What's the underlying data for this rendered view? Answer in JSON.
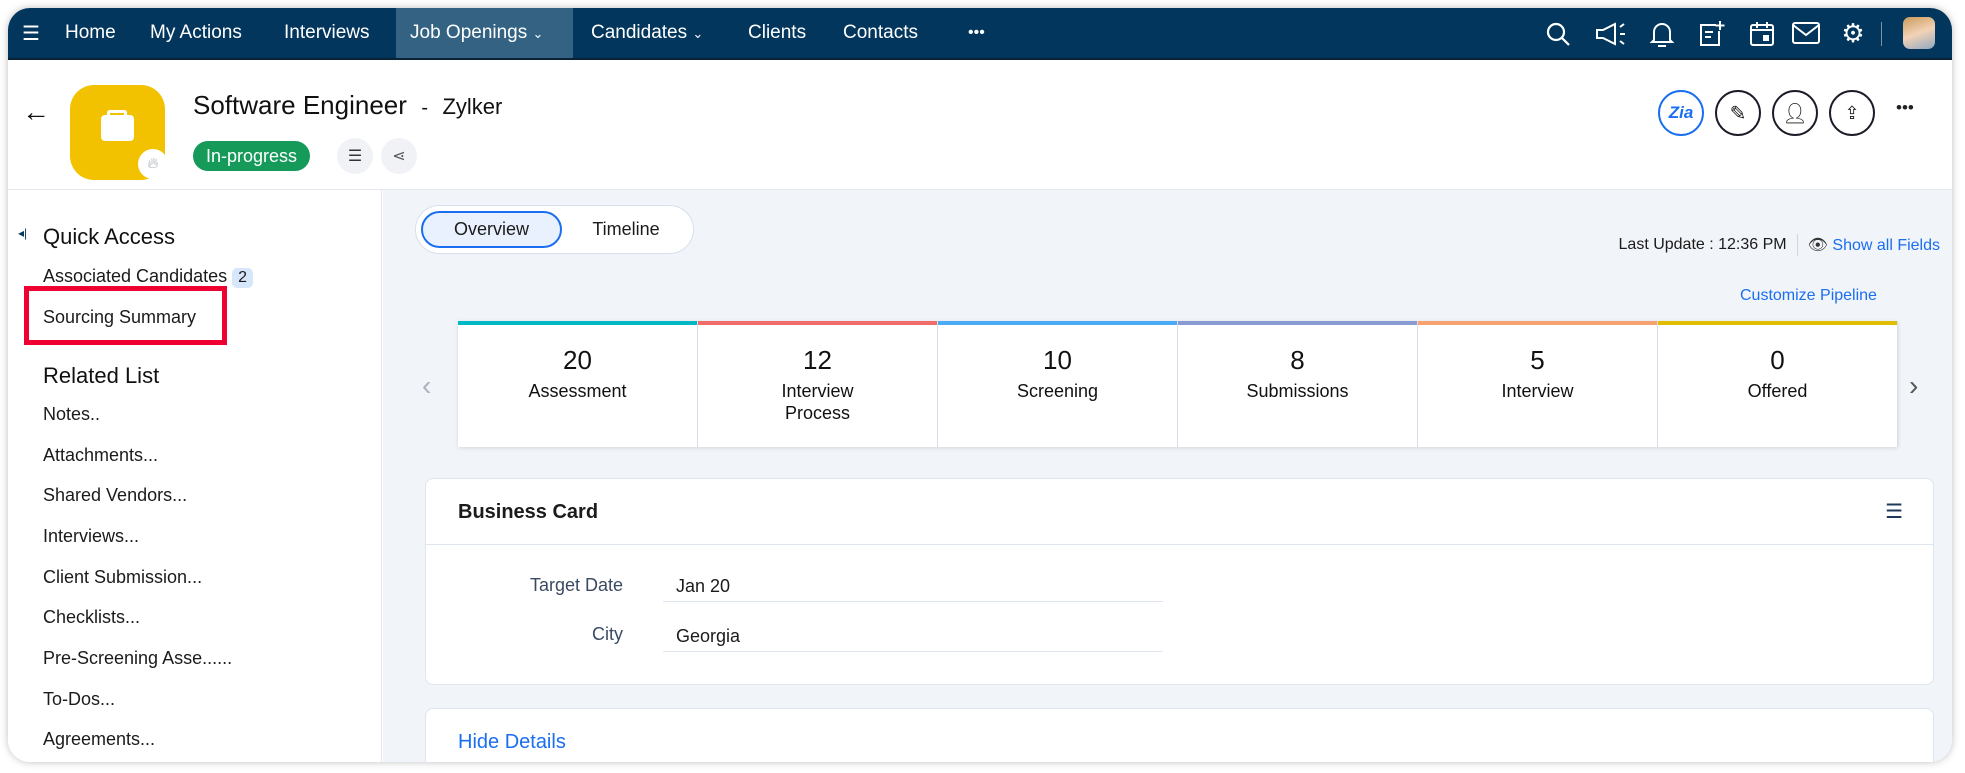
{
  "nav": {
    "items": [
      "Home",
      "My Actions",
      "Interviews",
      "Job Openings",
      "Candidates",
      "Clients",
      "Contacts"
    ],
    "active": "Job Openings",
    "more": "•••"
  },
  "header": {
    "title": "Software Engineer",
    "separator": "-",
    "client": "Zylker",
    "status": "In-progress",
    "status_color": "#159a5a",
    "logo_color": "#f2c200",
    "more": "•••"
  },
  "sidebar": {
    "quick_access": "Quick Access",
    "associated_candidates": "Associated Candidates",
    "associated_count": "2",
    "sourcing_summary": "Sourcing Summary",
    "related_list": "Related List",
    "related_items": [
      "Notes..",
      "Attachments...",
      "Shared Vendors...",
      "Interviews...",
      "Client Submission...",
      "Checklists...",
      "Pre-Screening Asse......",
      "To-Dos...",
      "Agreements..."
    ]
  },
  "main": {
    "tabs": [
      "Overview",
      "Timeline"
    ],
    "active_tab": "Overview",
    "last_update": "Last Update : 12:36 PM",
    "show_all_fields": "Show all Fields",
    "customize_pipeline": "Customize Pipeline",
    "pipeline": [
      {
        "count": "20",
        "label": "Assessment",
        "color": "#00b8c4"
      },
      {
        "count": "12",
        "label": "Interview Process",
        "color": "#f26b6b"
      },
      {
        "count": "10",
        "label": "Screening",
        "color": "#4aaaf5"
      },
      {
        "count": "8",
        "label": "Submissions",
        "color": "#8a9bd3"
      },
      {
        "count": "5",
        "label": "Interview",
        "color": "#f7a170"
      },
      {
        "count": "0",
        "label": "Offered",
        "color": "#e0bd00"
      }
    ],
    "business_card": {
      "title": "Business Card",
      "fields": [
        {
          "label": "Target Date",
          "value": "Jan 20"
        },
        {
          "label": "City",
          "value": "Georgia"
        }
      ]
    },
    "hide_details": "Hide Details"
  }
}
